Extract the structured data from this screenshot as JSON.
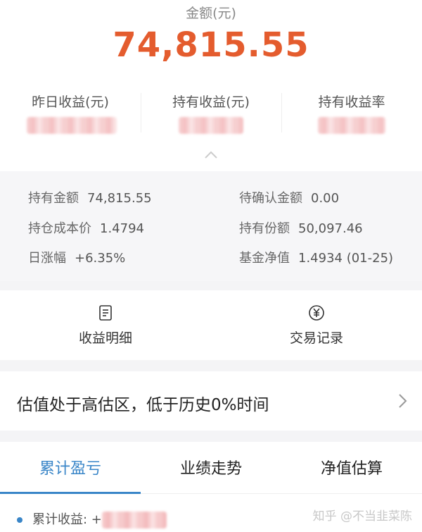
{
  "header": {
    "amount_label": "金额(元)",
    "amount_value": "74,815.55"
  },
  "metrics": [
    {
      "label": "昨日收益(元)"
    },
    {
      "label": "持有收益(元)"
    },
    {
      "label": "持有收益率"
    }
  ],
  "details": {
    "holding_amount": {
      "label": "持有金额",
      "value": "74,815.55"
    },
    "pending_amount": {
      "label": "待确认金额",
      "value": "0.00"
    },
    "cost_price": {
      "label": "持仓成本价",
      "value": "1.4794"
    },
    "holding_shares": {
      "label": "持有份额",
      "value": "50,097.46"
    },
    "daily_change": {
      "label": "日涨幅",
      "value": "+6.35%"
    },
    "nav": {
      "label": "基金净值",
      "value": "1.4934 (01-25)"
    }
  },
  "actions": {
    "income_detail": "收益明细",
    "trade_records": "交易记录"
  },
  "valuation": {
    "text": "估值处于高估区，低于历史0%时间"
  },
  "tabs": [
    {
      "label": "累计盈亏",
      "active": true
    },
    {
      "label": "业绩走势",
      "active": false
    },
    {
      "label": "净值估算",
      "active": false
    }
  ],
  "legend": {
    "label": "累计收益: +"
  },
  "watermark": "知乎 @不当韭菜陈",
  "colors": {
    "accent": "#3a86c8",
    "amount": "#e45c2e"
  }
}
